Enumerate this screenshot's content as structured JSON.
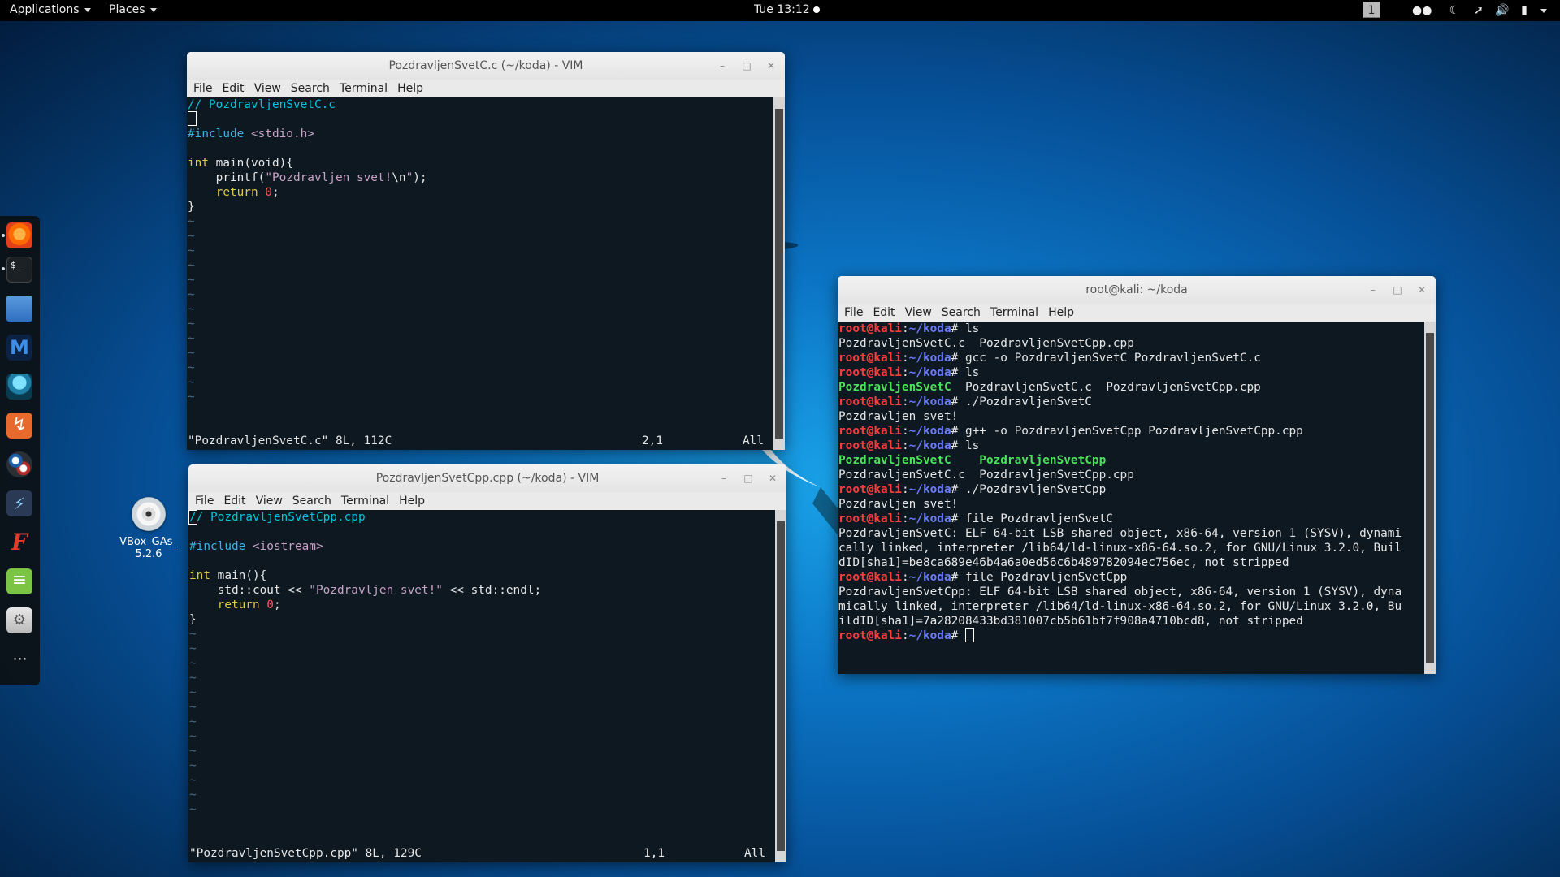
{
  "topbar": {
    "applications": "Applications",
    "places": "Places",
    "clock": "Tue 13:12",
    "workspace": "1"
  },
  "desktop": {
    "icon_label_1": "VBox_GAs_",
    "icon_label_2": "5.2.6"
  },
  "dock_items": [
    "firefox-icon",
    "terminal-icon",
    "files-icon",
    "metasploit-icon",
    "armitage-icon",
    "burpsuite-icon",
    "maltego-icon",
    "beef-icon",
    "faraday-icon",
    "text-editor-icon",
    "settings-icon",
    "show-apps-icon"
  ],
  "vim_c": {
    "title": "PozdravljenSvetC.c (~/koda) - VIM",
    "menu": [
      "File",
      "Edit",
      "View",
      "Search",
      "Terminal",
      "Help"
    ],
    "line1": "// PozdravljenSvetC.c",
    "include_kw": "#include",
    "include_hdr": " <stdio.h>",
    "int_kw": "int",
    "main_sig": " main(void){",
    "printf_pre": "    printf(",
    "printf_str": "\"Pozdravljen svet!",
    "printf_esc": "\\n",
    "printf_str_end": "\"",
    "printf_post": ");",
    "return_kw": "    return",
    "return_val": " 0",
    "semi": ";",
    "close_brace": "}",
    "status_file": "\"PozdravljenSvetC.c\" 8L, 112C",
    "status_pos": "2,1",
    "status_all": "All"
  },
  "vim_cpp": {
    "title": "PozdravljenSvetCpp.cpp (~/koda) - VIM",
    "menu": [
      "File",
      "Edit",
      "View",
      "Search",
      "Terminal",
      "Help"
    ],
    "line1_a": "/",
    "line1_b": "/ PozdravljenSvetCpp.cpp",
    "include_kw": "#include",
    "include_hdr": " <iostream>",
    "int_kw": "int",
    "main_sig": " main(){",
    "cout_pre": "    std::cout << ",
    "cout_str": "\"Pozdravljen svet!\"",
    "cout_post": " << std::endl;",
    "return_kw": "    return",
    "return_val": " 0",
    "semi": ";",
    "close_brace": "}",
    "status_file": "\"PozdravljenSvetCpp.cpp\" 8L, 129C",
    "status_pos": "1,1",
    "status_all": "All"
  },
  "terminal": {
    "title": "root@kali: ~/koda",
    "menu": [
      "File",
      "Edit",
      "View",
      "Search",
      "Terminal",
      "Help"
    ],
    "prompt_user": "root@kali",
    "prompt_colon": ":",
    "prompt_path": "~/koda",
    "prompt_hash": "# ",
    "cmd1": "ls",
    "out1": "PozdravljenSvetC.c  PozdravljenSvetCpp.cpp",
    "cmd2": "gcc -o PozdravljenSvetC PozdravljenSvetC.c",
    "cmd3": "ls",
    "out3_exec": "PozdravljenSvetC",
    "out3_rest": "  PozdravljenSvetC.c  PozdravljenSvetCpp.cpp",
    "cmd4": "./PozdravljenSvetC",
    "out4": "Pozdravljen svet!",
    "cmd5": "g++ -o PozdravljenSvetCpp PozdravljenSvetCpp.cpp",
    "cmd6": "ls",
    "out6_exec1": "PozdravljenSvetC",
    "out6_gap": "    ",
    "out6_exec2": "PozdravljenSvetCpp",
    "out6_line2": "PozdravljenSvetC.c  PozdravljenSvetCpp.cpp",
    "cmd7": "./PozdravljenSvetCpp",
    "out7": "Pozdravljen svet!",
    "cmd8": "file PozdravljenSvetC",
    "out8_l1": "PozdravljenSvetC: ELF 64-bit LSB shared object, x86-64, version 1 (SYSV), dynami",
    "out8_l2": "cally linked, interpreter /lib64/ld-linux-x86-64.so.2, for GNU/Linux 3.2.0, Buil",
    "out8_l3": "dID[sha1]=be8ca689e46b4a6a0ed56c6b489782094ec756ec, not stripped",
    "cmd9": "file PozdravljenSvetCpp",
    "out9_l1": "PozdravljenSvetCpp: ELF 64-bit LSB shared object, x86-64, version 1 (SYSV), dyna",
    "out9_l2": "mically linked, interpreter /lib64/ld-linux-x86-64.so.2, for GNU/Linux 3.2.0, Bu",
    "out9_l3": "ildID[sha1]=7a28208433bd381007cb5b61bf7f908a4710bcd8, not stripped"
  },
  "colors": {
    "prompt_user": "#ff3c3c",
    "prompt_path": "#6c7cff",
    "executable": "#4ae35b",
    "terminal_bg": "#0d1820"
  }
}
